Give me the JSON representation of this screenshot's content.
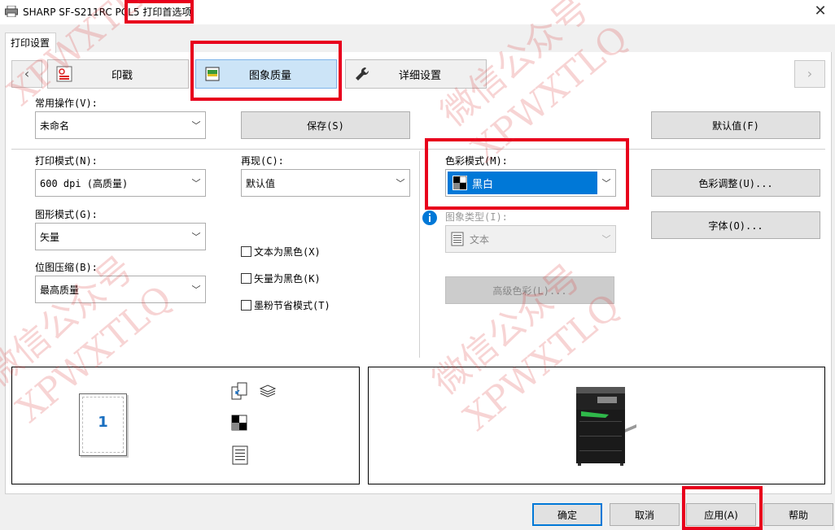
{
  "window": {
    "title_prefix": "SHARP SF-S211RC PCL5",
    "title_suffix": "打印首选项",
    "close": "✕"
  },
  "tab": {
    "label": "打印设置"
  },
  "nav": {
    "prev": "‹",
    "next": "›"
  },
  "categories": [
    {
      "label": "印戳",
      "icon": "stamp-icon"
    },
    {
      "label": "图象质量",
      "icon": "image-quality-icon",
      "active": true
    },
    {
      "label": "详细设置",
      "icon": "wrench-icon"
    }
  ],
  "common": {
    "label": "常用操作(V):",
    "value": "未命名",
    "save": "保存(S)",
    "defaults": "默认值(F)"
  },
  "print_mode": {
    "label": "打印模式(N):",
    "value": "600 dpi (高质量)"
  },
  "reproduce": {
    "label": "再现(C):",
    "value": "默认值"
  },
  "color_mode": {
    "label": "色彩模式(M):",
    "value": "黑白",
    "highlight": "#0078d7"
  },
  "graphics_mode": {
    "label": "图形模式(G):",
    "value": "矢量"
  },
  "image_type": {
    "label": "图象类型(I):",
    "value": "文本"
  },
  "bitmap_compression": {
    "label": "位图压缩(B):",
    "value": "最高质量"
  },
  "checkboxes": [
    {
      "label": "文本为黑色(X)"
    },
    {
      "label": "矢量为黑色(K)"
    },
    {
      "label": "墨粉节省模式(T)"
    }
  ],
  "buttons": {
    "color_adjust": "色彩调整(U)...",
    "font": "字体(O)...",
    "advanced_color": "高级色彩(L)..."
  },
  "preview": {
    "page_number": "1"
  },
  "footer": {
    "ok": "确定",
    "cancel": "取消",
    "apply": "应用(A)",
    "help": "帮助"
  },
  "watermark": {
    "line1": "微信公众号",
    "line2": "XPWXTLQ"
  },
  "colors": {
    "highlight_red": "#e8001c",
    "accent_blue": "#0078d7"
  }
}
